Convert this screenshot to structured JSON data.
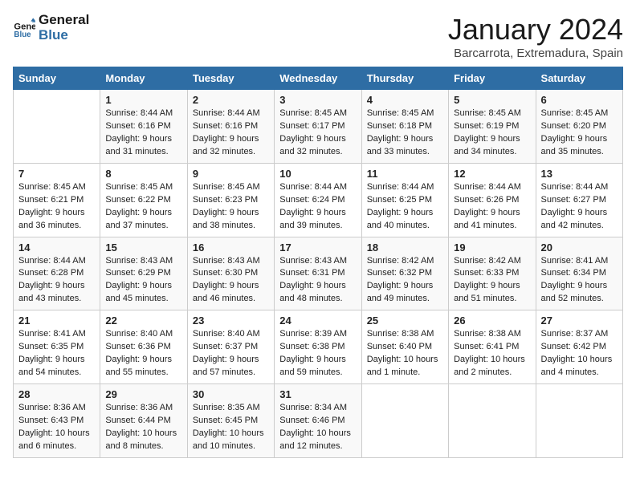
{
  "header": {
    "logo_line1": "General",
    "logo_line2": "Blue",
    "month": "January 2024",
    "location": "Barcarrota, Extremadura, Spain"
  },
  "days_of_week": [
    "Sunday",
    "Monday",
    "Tuesday",
    "Wednesday",
    "Thursday",
    "Friday",
    "Saturday"
  ],
  "weeks": [
    [
      {
        "day": "",
        "sunrise": "",
        "sunset": "",
        "daylight": ""
      },
      {
        "day": "1",
        "sunrise": "Sunrise: 8:44 AM",
        "sunset": "Sunset: 6:16 PM",
        "daylight": "Daylight: 9 hours and 31 minutes."
      },
      {
        "day": "2",
        "sunrise": "Sunrise: 8:44 AM",
        "sunset": "Sunset: 6:16 PM",
        "daylight": "Daylight: 9 hours and 32 minutes."
      },
      {
        "day": "3",
        "sunrise": "Sunrise: 8:45 AM",
        "sunset": "Sunset: 6:17 PM",
        "daylight": "Daylight: 9 hours and 32 minutes."
      },
      {
        "day": "4",
        "sunrise": "Sunrise: 8:45 AM",
        "sunset": "Sunset: 6:18 PM",
        "daylight": "Daylight: 9 hours and 33 minutes."
      },
      {
        "day": "5",
        "sunrise": "Sunrise: 8:45 AM",
        "sunset": "Sunset: 6:19 PM",
        "daylight": "Daylight: 9 hours and 34 minutes."
      },
      {
        "day": "6",
        "sunrise": "Sunrise: 8:45 AM",
        "sunset": "Sunset: 6:20 PM",
        "daylight": "Daylight: 9 hours and 35 minutes."
      }
    ],
    [
      {
        "day": "7",
        "sunrise": "Sunrise: 8:45 AM",
        "sunset": "Sunset: 6:21 PM",
        "daylight": "Daylight: 9 hours and 36 minutes."
      },
      {
        "day": "8",
        "sunrise": "Sunrise: 8:45 AM",
        "sunset": "Sunset: 6:22 PM",
        "daylight": "Daylight: 9 hours and 37 minutes."
      },
      {
        "day": "9",
        "sunrise": "Sunrise: 8:45 AM",
        "sunset": "Sunset: 6:23 PM",
        "daylight": "Daylight: 9 hours and 38 minutes."
      },
      {
        "day": "10",
        "sunrise": "Sunrise: 8:44 AM",
        "sunset": "Sunset: 6:24 PM",
        "daylight": "Daylight: 9 hours and 39 minutes."
      },
      {
        "day": "11",
        "sunrise": "Sunrise: 8:44 AM",
        "sunset": "Sunset: 6:25 PM",
        "daylight": "Daylight: 9 hours and 40 minutes."
      },
      {
        "day": "12",
        "sunrise": "Sunrise: 8:44 AM",
        "sunset": "Sunset: 6:26 PM",
        "daylight": "Daylight: 9 hours and 41 minutes."
      },
      {
        "day": "13",
        "sunrise": "Sunrise: 8:44 AM",
        "sunset": "Sunset: 6:27 PM",
        "daylight": "Daylight: 9 hours and 42 minutes."
      }
    ],
    [
      {
        "day": "14",
        "sunrise": "Sunrise: 8:44 AM",
        "sunset": "Sunset: 6:28 PM",
        "daylight": "Daylight: 9 hours and 43 minutes."
      },
      {
        "day": "15",
        "sunrise": "Sunrise: 8:43 AM",
        "sunset": "Sunset: 6:29 PM",
        "daylight": "Daylight: 9 hours and 45 minutes."
      },
      {
        "day": "16",
        "sunrise": "Sunrise: 8:43 AM",
        "sunset": "Sunset: 6:30 PM",
        "daylight": "Daylight: 9 hours and 46 minutes."
      },
      {
        "day": "17",
        "sunrise": "Sunrise: 8:43 AM",
        "sunset": "Sunset: 6:31 PM",
        "daylight": "Daylight: 9 hours and 48 minutes."
      },
      {
        "day": "18",
        "sunrise": "Sunrise: 8:42 AM",
        "sunset": "Sunset: 6:32 PM",
        "daylight": "Daylight: 9 hours and 49 minutes."
      },
      {
        "day": "19",
        "sunrise": "Sunrise: 8:42 AM",
        "sunset": "Sunset: 6:33 PM",
        "daylight": "Daylight: 9 hours and 51 minutes."
      },
      {
        "day": "20",
        "sunrise": "Sunrise: 8:41 AM",
        "sunset": "Sunset: 6:34 PM",
        "daylight": "Daylight: 9 hours and 52 minutes."
      }
    ],
    [
      {
        "day": "21",
        "sunrise": "Sunrise: 8:41 AM",
        "sunset": "Sunset: 6:35 PM",
        "daylight": "Daylight: 9 hours and 54 minutes."
      },
      {
        "day": "22",
        "sunrise": "Sunrise: 8:40 AM",
        "sunset": "Sunset: 6:36 PM",
        "daylight": "Daylight: 9 hours and 55 minutes."
      },
      {
        "day": "23",
        "sunrise": "Sunrise: 8:40 AM",
        "sunset": "Sunset: 6:37 PM",
        "daylight": "Daylight: 9 hours and 57 minutes."
      },
      {
        "day": "24",
        "sunrise": "Sunrise: 8:39 AM",
        "sunset": "Sunset: 6:38 PM",
        "daylight": "Daylight: 9 hours and 59 minutes."
      },
      {
        "day": "25",
        "sunrise": "Sunrise: 8:38 AM",
        "sunset": "Sunset: 6:40 PM",
        "daylight": "Daylight: 10 hours and 1 minute."
      },
      {
        "day": "26",
        "sunrise": "Sunrise: 8:38 AM",
        "sunset": "Sunset: 6:41 PM",
        "daylight": "Daylight: 10 hours and 2 minutes."
      },
      {
        "day": "27",
        "sunrise": "Sunrise: 8:37 AM",
        "sunset": "Sunset: 6:42 PM",
        "daylight": "Daylight: 10 hours and 4 minutes."
      }
    ],
    [
      {
        "day": "28",
        "sunrise": "Sunrise: 8:36 AM",
        "sunset": "Sunset: 6:43 PM",
        "daylight": "Daylight: 10 hours and 6 minutes."
      },
      {
        "day": "29",
        "sunrise": "Sunrise: 8:36 AM",
        "sunset": "Sunset: 6:44 PM",
        "daylight": "Daylight: 10 hours and 8 minutes."
      },
      {
        "day": "30",
        "sunrise": "Sunrise: 8:35 AM",
        "sunset": "Sunset: 6:45 PM",
        "daylight": "Daylight: 10 hours and 10 minutes."
      },
      {
        "day": "31",
        "sunrise": "Sunrise: 8:34 AM",
        "sunset": "Sunset: 6:46 PM",
        "daylight": "Daylight: 10 hours and 12 minutes."
      },
      {
        "day": "",
        "sunrise": "",
        "sunset": "",
        "daylight": ""
      },
      {
        "day": "",
        "sunrise": "",
        "sunset": "",
        "daylight": ""
      },
      {
        "day": "",
        "sunrise": "",
        "sunset": "",
        "daylight": ""
      }
    ]
  ]
}
